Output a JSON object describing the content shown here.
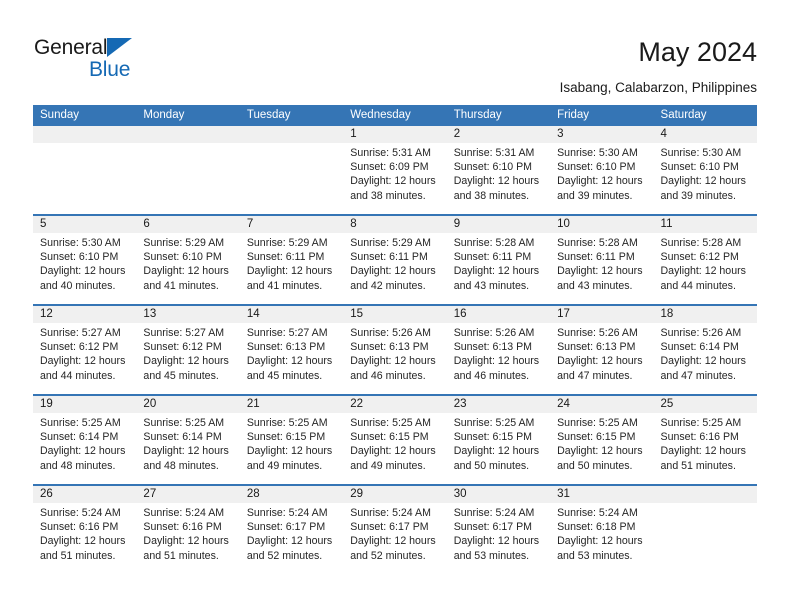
{
  "brand": {
    "name_top": "General",
    "name_bottom": "Blue",
    "triangle_color": "#1569b4"
  },
  "header": {
    "title": "May 2024",
    "subtitle": "Isabang, Calabarzon, Philippines"
  },
  "theme": {
    "header_blue": "#3575b5",
    "date_band_gray": "#f0f0f0",
    "text_color": "#1a1a1a"
  },
  "calendar": {
    "weekday_headers": [
      "Sunday",
      "Monday",
      "Tuesday",
      "Wednesday",
      "Thursday",
      "Friday",
      "Saturday"
    ],
    "weeks": [
      {
        "dates": [
          "",
          "",
          "",
          "1",
          "2",
          "3",
          "4"
        ],
        "cells": [
          {
            "lines": []
          },
          {
            "lines": []
          },
          {
            "lines": []
          },
          {
            "lines": [
              "Sunrise: 5:31 AM",
              "Sunset: 6:09 PM",
              "Daylight: 12 hours",
              "and 38 minutes."
            ]
          },
          {
            "lines": [
              "Sunrise: 5:31 AM",
              "Sunset: 6:10 PM",
              "Daylight: 12 hours",
              "and 38 minutes."
            ]
          },
          {
            "lines": [
              "Sunrise: 5:30 AM",
              "Sunset: 6:10 PM",
              "Daylight: 12 hours",
              "and 39 minutes."
            ]
          },
          {
            "lines": [
              "Sunrise: 5:30 AM",
              "Sunset: 6:10 PM",
              "Daylight: 12 hours",
              "and 39 minutes."
            ]
          }
        ]
      },
      {
        "dates": [
          "5",
          "6",
          "7",
          "8",
          "9",
          "10",
          "11"
        ],
        "cells": [
          {
            "lines": [
              "Sunrise: 5:30 AM",
              "Sunset: 6:10 PM",
              "Daylight: 12 hours",
              "and 40 minutes."
            ]
          },
          {
            "lines": [
              "Sunrise: 5:29 AM",
              "Sunset: 6:10 PM",
              "Daylight: 12 hours",
              "and 41 minutes."
            ]
          },
          {
            "lines": [
              "Sunrise: 5:29 AM",
              "Sunset: 6:11 PM",
              "Daylight: 12 hours",
              "and 41 minutes."
            ]
          },
          {
            "lines": [
              "Sunrise: 5:29 AM",
              "Sunset: 6:11 PM",
              "Daylight: 12 hours",
              "and 42 minutes."
            ]
          },
          {
            "lines": [
              "Sunrise: 5:28 AM",
              "Sunset: 6:11 PM",
              "Daylight: 12 hours",
              "and 43 minutes."
            ]
          },
          {
            "lines": [
              "Sunrise: 5:28 AM",
              "Sunset: 6:11 PM",
              "Daylight: 12 hours",
              "and 43 minutes."
            ]
          },
          {
            "lines": [
              "Sunrise: 5:28 AM",
              "Sunset: 6:12 PM",
              "Daylight: 12 hours",
              "and 44 minutes."
            ]
          }
        ]
      },
      {
        "dates": [
          "12",
          "13",
          "14",
          "15",
          "16",
          "17",
          "18"
        ],
        "cells": [
          {
            "lines": [
              "Sunrise: 5:27 AM",
              "Sunset: 6:12 PM",
              "Daylight: 12 hours",
              "and 44 minutes."
            ]
          },
          {
            "lines": [
              "Sunrise: 5:27 AM",
              "Sunset: 6:12 PM",
              "Daylight: 12 hours",
              "and 45 minutes."
            ]
          },
          {
            "lines": [
              "Sunrise: 5:27 AM",
              "Sunset: 6:13 PM",
              "Daylight: 12 hours",
              "and 45 minutes."
            ]
          },
          {
            "lines": [
              "Sunrise: 5:26 AM",
              "Sunset: 6:13 PM",
              "Daylight: 12 hours",
              "and 46 minutes."
            ]
          },
          {
            "lines": [
              "Sunrise: 5:26 AM",
              "Sunset: 6:13 PM",
              "Daylight: 12 hours",
              "and 46 minutes."
            ]
          },
          {
            "lines": [
              "Sunrise: 5:26 AM",
              "Sunset: 6:13 PM",
              "Daylight: 12 hours",
              "and 47 minutes."
            ]
          },
          {
            "lines": [
              "Sunrise: 5:26 AM",
              "Sunset: 6:14 PM",
              "Daylight: 12 hours",
              "and 47 minutes."
            ]
          }
        ]
      },
      {
        "dates": [
          "19",
          "20",
          "21",
          "22",
          "23",
          "24",
          "25"
        ],
        "cells": [
          {
            "lines": [
              "Sunrise: 5:25 AM",
              "Sunset: 6:14 PM",
              "Daylight: 12 hours",
              "and 48 minutes."
            ]
          },
          {
            "lines": [
              "Sunrise: 5:25 AM",
              "Sunset: 6:14 PM",
              "Daylight: 12 hours",
              "and 48 minutes."
            ]
          },
          {
            "lines": [
              "Sunrise: 5:25 AM",
              "Sunset: 6:15 PM",
              "Daylight: 12 hours",
              "and 49 minutes."
            ]
          },
          {
            "lines": [
              "Sunrise: 5:25 AM",
              "Sunset: 6:15 PM",
              "Daylight: 12 hours",
              "and 49 minutes."
            ]
          },
          {
            "lines": [
              "Sunrise: 5:25 AM",
              "Sunset: 6:15 PM",
              "Daylight: 12 hours",
              "and 50 minutes."
            ]
          },
          {
            "lines": [
              "Sunrise: 5:25 AM",
              "Sunset: 6:15 PM",
              "Daylight: 12 hours",
              "and 50 minutes."
            ]
          },
          {
            "lines": [
              "Sunrise: 5:25 AM",
              "Sunset: 6:16 PM",
              "Daylight: 12 hours",
              "and 51 minutes."
            ]
          }
        ]
      },
      {
        "dates": [
          "26",
          "27",
          "28",
          "29",
          "30",
          "31",
          ""
        ],
        "cells": [
          {
            "lines": [
              "Sunrise: 5:24 AM",
              "Sunset: 6:16 PM",
              "Daylight: 12 hours",
              "and 51 minutes."
            ]
          },
          {
            "lines": [
              "Sunrise: 5:24 AM",
              "Sunset: 6:16 PM",
              "Daylight: 12 hours",
              "and 51 minutes."
            ]
          },
          {
            "lines": [
              "Sunrise: 5:24 AM",
              "Sunset: 6:17 PM",
              "Daylight: 12 hours",
              "and 52 minutes."
            ]
          },
          {
            "lines": [
              "Sunrise: 5:24 AM",
              "Sunset: 6:17 PM",
              "Daylight: 12 hours",
              "and 52 minutes."
            ]
          },
          {
            "lines": [
              "Sunrise: 5:24 AM",
              "Sunset: 6:17 PM",
              "Daylight: 12 hours",
              "and 53 minutes."
            ]
          },
          {
            "lines": [
              "Sunrise: 5:24 AM",
              "Sunset: 6:18 PM",
              "Daylight: 12 hours",
              "and 53 minutes."
            ]
          },
          {
            "lines": []
          }
        ]
      }
    ]
  }
}
